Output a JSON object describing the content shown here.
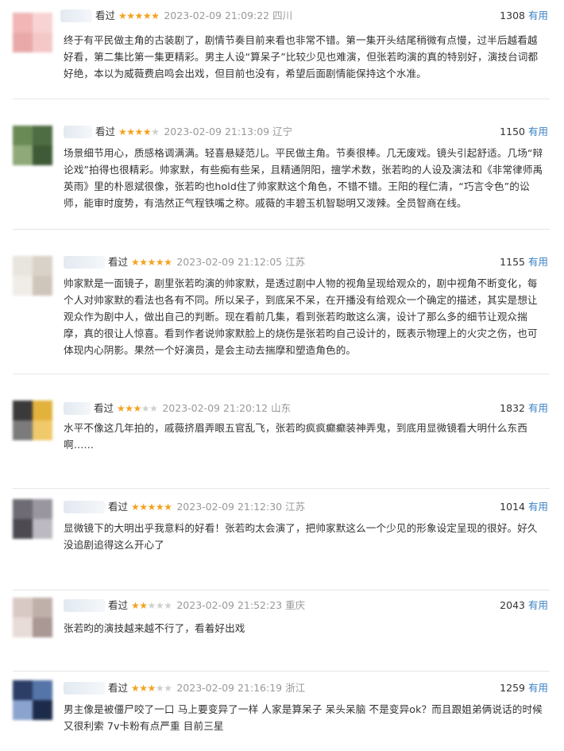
{
  "colors": {
    "star": "#f4a21f",
    "star_off": "#cfcfcf",
    "link": "#3b82c4",
    "muted": "#999999",
    "text": "#333333"
  },
  "icons": {
    "star_filled": "★",
    "star_empty": "★"
  },
  "reviews": [
    {
      "seen": "看过",
      "rating": 5,
      "time": "2023-02-09 21:09:22",
      "location": "四川",
      "votes": "1308",
      "useful": "有用",
      "text": "终于有平民做主角的古装剧了，剧情节奏目前来看也非常不错。第一集开头结尾稍微有点慢，过半后越看越好看，第二集比第一集更精彩。男主人设“算呆子”比较少见也难演，但张若昀演的真的特别好，演技台词都好绝，本以为威薇费启鸣会出戏，但目前也没有，希望后面剧情能保持这个水准。"
    },
    {
      "seen": "看过",
      "rating": 4,
      "time": "2023-02-09 21:13:09",
      "location": "辽宁",
      "votes": "1150",
      "useful": "有用",
      "text": "场景细节用心，质感格调满满。轻喜悬疑范儿。平民做主角。节奏很棒。几无废戏。镜头引起舒适。几场“辩论戏”拍得也很精彩。帅家默，有些痴有些呆，且精通阴阳，擅学术数，张若昀的人设及演法和《非常律师禹英雨》里的朴恩斌很像，张若昀也hold住了帅家默这个角色，不错不错。王阳的程仁清，“巧言令色”的讼师，能审时度势，有浩然正气程铁嘴之称。戚薇的丰碧玉机智聪明又泼辣。全员智商在线。"
    },
    {
      "seen": "看过",
      "rating": 5,
      "time": "2023-02-09 21:12:05",
      "location": "江苏",
      "votes": "1155",
      "useful": "有用",
      "text": "帅家默是一面镜子，剧里张若昀演的帅家默，是透过剧中人物的视角呈现给观众的，剧中视角不断变化，每个人对帅家默的看法也各有不同。所以呆子，到底呆不呆，在开播没有给观众一个确定的描述，其实是想让观众作为剧中人，做出自己的判断。现在看前几集，看到张若昀敢这么演，设计了那么多的细节让观众揣摩，真的很让人惊喜。看到作者说帅家默脸上的烧伤是张若昀自己设计的，既表示物理上的火灾之伤，也可体现内心阴影。果然一个好演员，是会主动去揣摩和塑造角色的。"
    },
    {
      "seen": "看过",
      "rating": 3,
      "time": "2023-02-09 21:20:12",
      "location": "山东",
      "votes": "1832",
      "useful": "有用",
      "text": "水平不像这几年拍的，戚薇挤眉弄眼五官乱飞，张若昀疯疯癫癫装神弄鬼，到底用显微镜看大明什么东西啊……"
    },
    {
      "seen": "看过",
      "rating": 5,
      "time": "2023-02-09 21:12:30",
      "location": "江苏",
      "votes": "1014",
      "useful": "有用",
      "text": "显微镜下的大明出乎我意料的好看！张若昀太会演了，把帅家默这么一个少见的形象设定呈现的很好。好久没追剧追得这么开心了"
    },
    {
      "seen": "看过",
      "rating": 2,
      "time": "2023-02-09 21:52:23",
      "location": "重庆",
      "votes": "2043",
      "useful": "有用",
      "text": "张若昀的演技越来越不行了，看着好出戏"
    },
    {
      "seen": "看过",
      "rating": 3,
      "time": "2023-02-09 21:16:19",
      "location": "浙江",
      "votes": "1259",
      "useful": "有用",
      "text": "男主像是被僵尸咬了一口 马上要变异了一样 人家是算呆子 呆头呆脑 不是变异ok？而且跟姐弟俩说话的时候又很利索 7v卡粉有点严重 目前三星"
    }
  ]
}
